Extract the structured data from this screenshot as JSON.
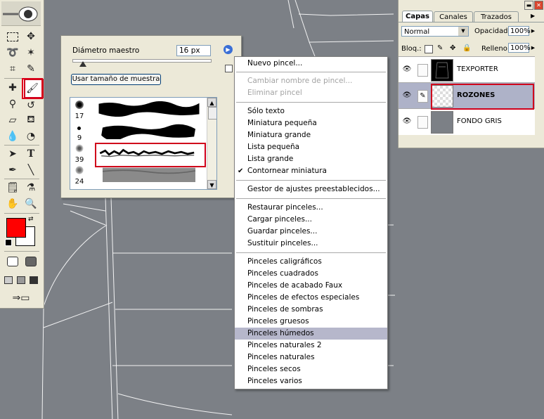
{
  "canvas": {
    "background": "#7c8086"
  },
  "toolbox": {
    "foreground_color": "#ff0000",
    "background_color": "#ffffff",
    "text_tool_glyph": "T",
    "selected_tool": "brush-tool"
  },
  "brush_panel": {
    "master_diameter_label": "Diámetro maestro",
    "master_diameter_value": "16 px",
    "use_sample_size_label": "Usar tamaño de muestra",
    "brushes": [
      {
        "size": "17"
      },
      {
        "size": "9"
      },
      {
        "size": "39",
        "selected": true
      },
      {
        "size": "24"
      }
    ]
  },
  "context_menu": {
    "groups": [
      [
        {
          "label": "Nuevo pincel...",
          "enabled": true
        }
      ],
      [
        {
          "label": "Cambiar nombre de pincel...",
          "enabled": false
        },
        {
          "label": "Eliminar pincel",
          "enabled": false
        }
      ],
      [
        {
          "label": "Sólo texto",
          "enabled": true
        },
        {
          "label": "Miniatura pequeña",
          "enabled": true
        },
        {
          "label": "Miniatura grande",
          "enabled": true
        },
        {
          "label": "Lista pequeña",
          "enabled": true
        },
        {
          "label": "Lista grande",
          "enabled": true
        },
        {
          "label": "Contornear miniatura",
          "enabled": true,
          "checked": true
        }
      ],
      [
        {
          "label": "Gestor de ajustes preestablecidos...",
          "enabled": true
        }
      ],
      [
        {
          "label": "Restaurar pinceles...",
          "enabled": true
        },
        {
          "label": "Cargar pinceles...",
          "enabled": true
        },
        {
          "label": "Guardar pinceles...",
          "enabled": true
        },
        {
          "label": "Sustituir pinceles...",
          "enabled": true
        }
      ],
      [
        {
          "label": "Pinceles caligráficos",
          "enabled": true
        },
        {
          "label": "Pinceles cuadrados",
          "enabled": true
        },
        {
          "label": "Pinceles de acabado Faux",
          "enabled": true
        },
        {
          "label": "Pinceles de efectos especiales",
          "enabled": true
        },
        {
          "label": "Pinceles de sombras",
          "enabled": true
        },
        {
          "label": "Pinceles gruesos",
          "enabled": true
        },
        {
          "label": "Pinceles húmedos",
          "enabled": true,
          "highlighted": true
        },
        {
          "label": "Pinceles naturales 2",
          "enabled": true
        },
        {
          "label": "Pinceles naturales",
          "enabled": true
        },
        {
          "label": "Pinceles secos",
          "enabled": true
        },
        {
          "label": "Pinceles varios",
          "enabled": true
        }
      ]
    ]
  },
  "layers_panel": {
    "tabs": [
      "Capas",
      "Canales",
      "Trazados"
    ],
    "active_tab": "Capas",
    "blend_mode": "Normal",
    "opacity_label": "Opacidad:",
    "opacity_value": "100%",
    "lock_label": "Bloq.:",
    "fill_label": "Relleno:",
    "fill_value": "100%",
    "layers": [
      {
        "name": "TEXPORTER",
        "visible": true,
        "selected": false,
        "thumb_color": "#000000"
      },
      {
        "name": "ROZONES",
        "visible": true,
        "selected": true,
        "thumb_color": "transparent"
      },
      {
        "name": "FONDO GRIS",
        "visible": true,
        "selected": false,
        "thumb_color": "#7c8086"
      }
    ]
  }
}
